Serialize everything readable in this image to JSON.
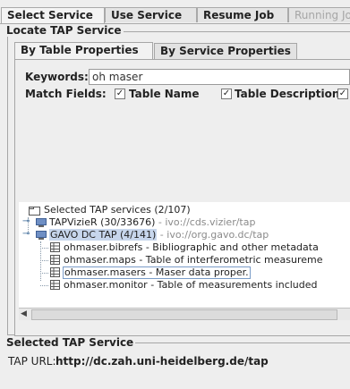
{
  "top_tabs": [
    "Select Service",
    "Use Service",
    "Resume Job",
    "Running Jo"
  ],
  "locate_group_title": "Locate TAP Service",
  "inner_tabs": [
    "By Table Properties",
    "By Service Properties"
  ],
  "keywords": {
    "label": "Keywords:",
    "value": "oh maser"
  },
  "match_fields": {
    "label": "Match Fields:",
    "options": [
      {
        "label": "Table Name",
        "checked": true
      },
      {
        "label": "Table Description",
        "checked": true
      }
    ]
  },
  "tree": {
    "root": "Selected TAP services (2/107)",
    "services": [
      {
        "name": "TAPVizieR (30/33676)",
        "ivo": "- ivo://cds.vizier/tap"
      },
      {
        "name": "GAVO DC TAP (4/141)",
        "ivo": "- ivo://org.gavo.dc/tap"
      }
    ],
    "tables": [
      "ohmaser.bibrefs - Bibliographic and other metadata",
      "ohmaser.maps - Table of interferometric measureme",
      "ohmaser.masers - Maser data proper.",
      "ohmaser.monitor - Table of measurements included"
    ]
  },
  "selected_group_title": "Selected TAP Service",
  "tap_url": {
    "label": "TAP URL:",
    "value": "http://dc.zah.uni-heidelberg.de/tap"
  }
}
